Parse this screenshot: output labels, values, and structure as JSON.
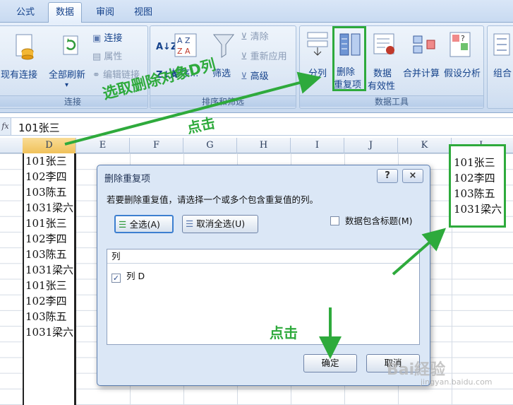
{
  "ribbon_tabs": [
    "公式",
    "数据",
    "审阅",
    "视图"
  ],
  "active_tab": "数据",
  "ribbon": {
    "connections_group": {
      "existing": "现有连接",
      "refresh_all": "全部刷新",
      "connections": "连接",
      "properties": "属性",
      "edit_links": "编辑链接",
      "label": "连接"
    },
    "sort_filter_group": {
      "sort": "排序...",
      "filter": "筛选",
      "clear": "清除",
      "reapply": "重新应用",
      "advanced": "高级",
      "label": "排序和筛选"
    },
    "data_tools_group": {
      "text_to_columns": "分列",
      "remove_duplicates_line1": "删除",
      "remove_duplicates_line2": "重复项",
      "validation_line1": "数据",
      "validation_line2": "有效性",
      "consolidate": "合并计算",
      "what_if": "假设分析",
      "label": "数据工具"
    },
    "outline_group": {
      "group": "组合"
    }
  },
  "formula_bar": {
    "fx": "fx",
    "value": "101张三"
  },
  "columns": [
    "D",
    "E",
    "F",
    "G",
    "H",
    "I",
    "J",
    "K",
    "L"
  ],
  "selected_column": "D",
  "column_d_values": [
    "101张三",
    "102李四",
    "103陈五",
    "1031梁六",
    "101张三",
    "102李四",
    "103陈五",
    "1031梁六",
    "101张三",
    "102李四",
    "103陈五",
    "1031梁六"
  ],
  "column_l_values": [
    "101张三",
    "102李四",
    "103陈五",
    "1031梁六"
  ],
  "dialog": {
    "title": "删除重复项",
    "help": "?",
    "close": "×",
    "description": "若要删除重复值，请选择一个或多个包含重复值的列。",
    "select_all": "全选(A)",
    "unselect_all": "取消全选(U)",
    "has_headers": "数据包含标题(M)",
    "has_headers_checked": false,
    "list_header": "列",
    "list_item": "列 D",
    "list_item_checked": true,
    "ok": "确定",
    "cancel": "取消"
  },
  "annotations": {
    "select_target": "选取删除对象D列",
    "click_1": "点击",
    "click_2": "点击",
    "color": "#2eaa3c"
  },
  "watermark": {
    "brand": "Bai経验",
    "sub": "jingyan.baidu.com"
  }
}
